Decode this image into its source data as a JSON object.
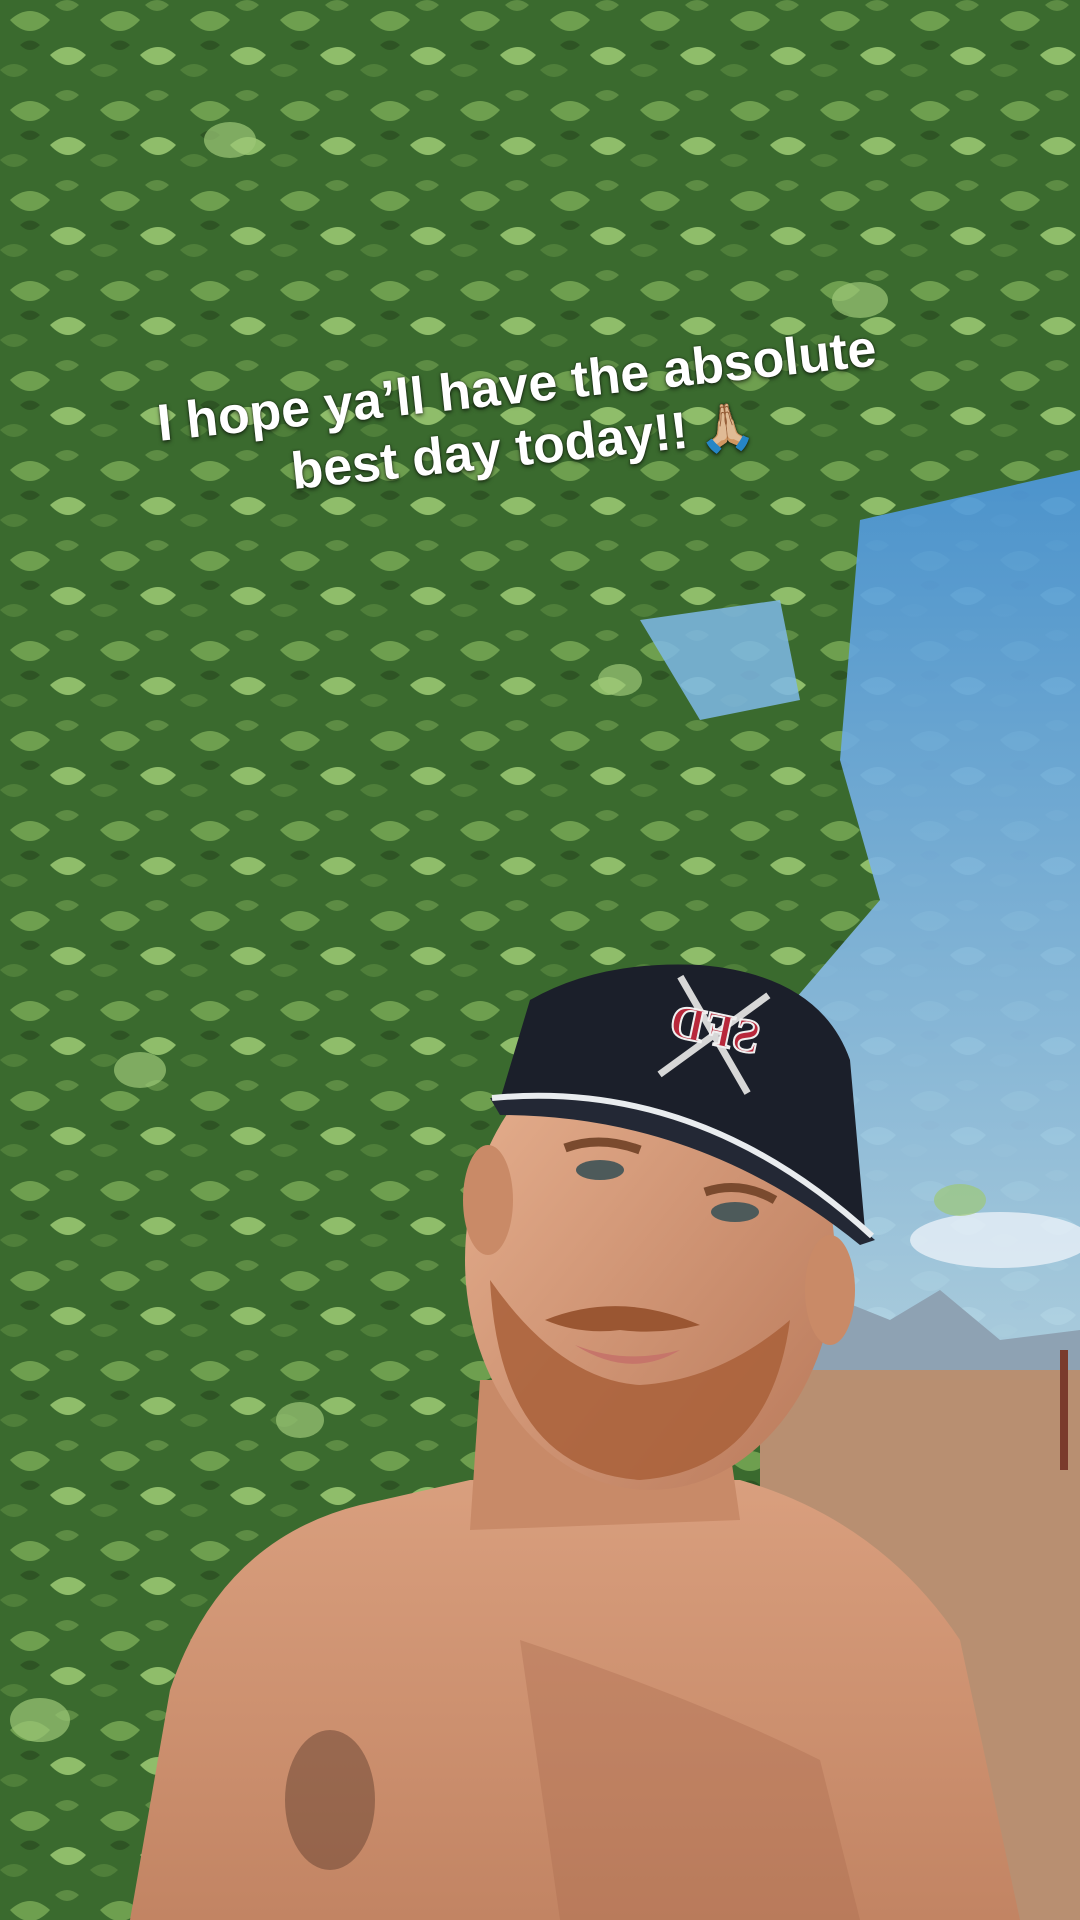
{
  "caption": {
    "line1": "I hope ya’ll have the absolute",
    "line2": "best day today!!",
    "emoji": "🙏🏼"
  },
  "scene": {
    "hat_logo_text": "SFD",
    "colors": {
      "sky": "#6fb2e8",
      "foliage_dark": "#2f5a26",
      "foliage_light": "#7fae5c",
      "hat": "#1b1f2a",
      "hat_brim_trim": "#e9ecef",
      "skin": "#d79a78",
      "beard": "#b0663d",
      "ground": "#b78f72"
    }
  }
}
